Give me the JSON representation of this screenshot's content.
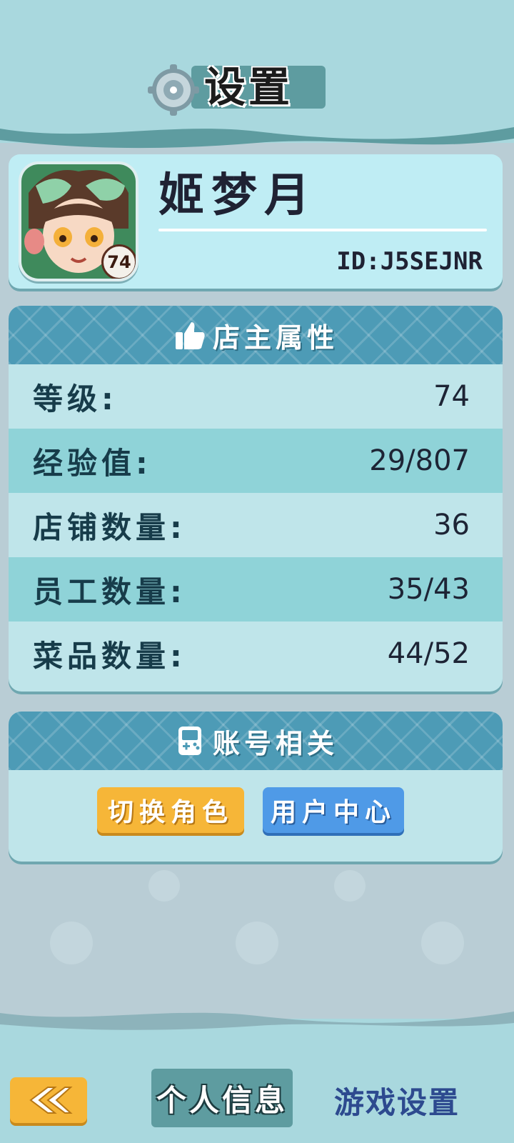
{
  "header": {
    "title": "设置",
    "icon": "gear-icon"
  },
  "profile": {
    "name": "姬梦月",
    "id_text": "ID:J5SEJNR",
    "level_badge": "74"
  },
  "attributes": {
    "title": "店主属性",
    "icon": "thumbs-up-icon",
    "rows": [
      {
        "label": "等级:",
        "value": "74"
      },
      {
        "label": "经验值:",
        "value": "29/807"
      },
      {
        "label": "店铺数量:",
        "value": "36"
      },
      {
        "label": "员工数量:",
        "value": "35/43"
      },
      {
        "label": "菜品数量:",
        "value": "44/52"
      }
    ]
  },
  "account": {
    "title": "账号相关",
    "icon": "gamepad-icon",
    "switch_role": "切换角色",
    "user_center": "用户中心"
  },
  "footer": {
    "back_icon": "chevron-left-icon",
    "tab_personal": "个人信息",
    "tab_game_settings": "游戏设置"
  },
  "colors": {
    "header_bg": "#a9d8de",
    "panel_head": "#4d9bb6",
    "row_alt": "#8fd3d8",
    "button_orange": "#f6b638",
    "button_blue": "#4f9ae7",
    "tab_active": "#5e9ca0"
  }
}
